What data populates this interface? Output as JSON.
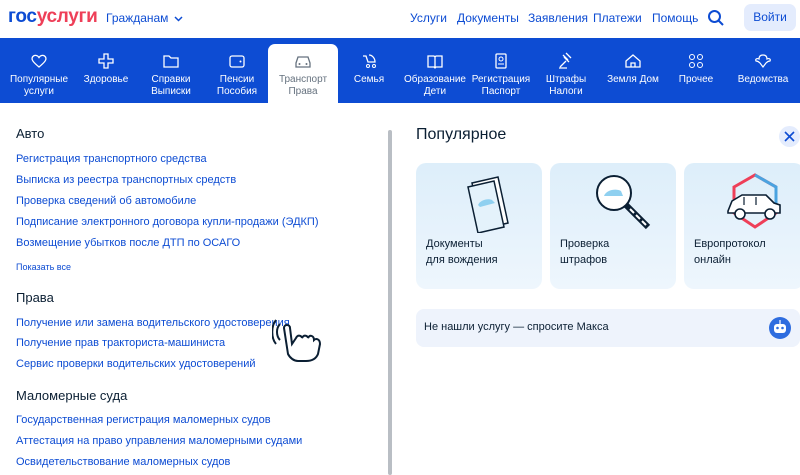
{
  "header": {
    "logo_part1": "гос",
    "logo_part2": "услуги",
    "citizens": "Гражданам",
    "nav": [
      "Услуги",
      "Документы",
      "Заявления",
      "Платежи",
      "Помощь"
    ],
    "login": "Войти"
  },
  "categories": [
    {
      "line1": "Популярные",
      "line2": "услуги",
      "icon": "heart-icon"
    },
    {
      "line1": "Здоровье",
      "line2": "",
      "icon": "cross-icon"
    },
    {
      "line1": "Справки",
      "line2": "Выписки",
      "icon": "folder-icon"
    },
    {
      "line1": "Пенсии",
      "line2": "Пособия",
      "icon": "wallet-icon"
    },
    {
      "line1": "Транспорт",
      "line2": "Права",
      "icon": "car-icon"
    },
    {
      "line1": "Семья",
      "line2": "",
      "icon": "stroller-icon"
    },
    {
      "line1": "Образование",
      "line2": "Дети",
      "icon": "book-icon"
    },
    {
      "line1": "Регистрация",
      "line2": "Паспорт",
      "icon": "id-card-icon"
    },
    {
      "line1": "Штрафы",
      "line2": "Налоги",
      "icon": "gavel-icon"
    },
    {
      "line1": "Земля Дом",
      "line2": "",
      "icon": "house-icon"
    },
    {
      "line1": "Прочее",
      "line2": "",
      "icon": "grid-icon"
    },
    {
      "line1": "Ведомства",
      "line2": "",
      "icon": "emblem-icon"
    }
  ],
  "auto": {
    "title": "Авто",
    "links": [
      "Регистрация транспортного средства",
      "Выписка из реестра транспортных средств",
      "Проверка сведений об автомобиле",
      "Подписание электронного договора купли-продажи (ЭДКП)",
      "Возмещение убытков после ДТП по ОСАГО"
    ],
    "show_all": "Показать все"
  },
  "rights": {
    "title": "Права",
    "links": [
      "Получение или замена водительского удостоверения",
      "Получение прав тракториста-машиниста",
      "Сервис проверки водительских удостоверений"
    ]
  },
  "boats": {
    "title": "Маломерные суда",
    "links": [
      "Государственная регистрация маломерных судов",
      "Аттестация на право управления маломерными судами",
      "Освидетельствование маломерных судов"
    ]
  },
  "popular": {
    "title": "Популярное",
    "cards": [
      {
        "line1": "Документы",
        "line2": "для вождения",
        "icon": "documents-icon"
      },
      {
        "line1": "Проверка",
        "line2": "штрафов",
        "icon": "magnifier-car-icon"
      },
      {
        "line1": "Европротокол",
        "line2": "онлайн",
        "icon": "car-protocol-icon"
      }
    ],
    "ask": "Не нашли услугу — спросите Макса"
  },
  "colors": {
    "brand_blue": "#0d4cd3",
    "brand_red": "#ee3f58"
  }
}
